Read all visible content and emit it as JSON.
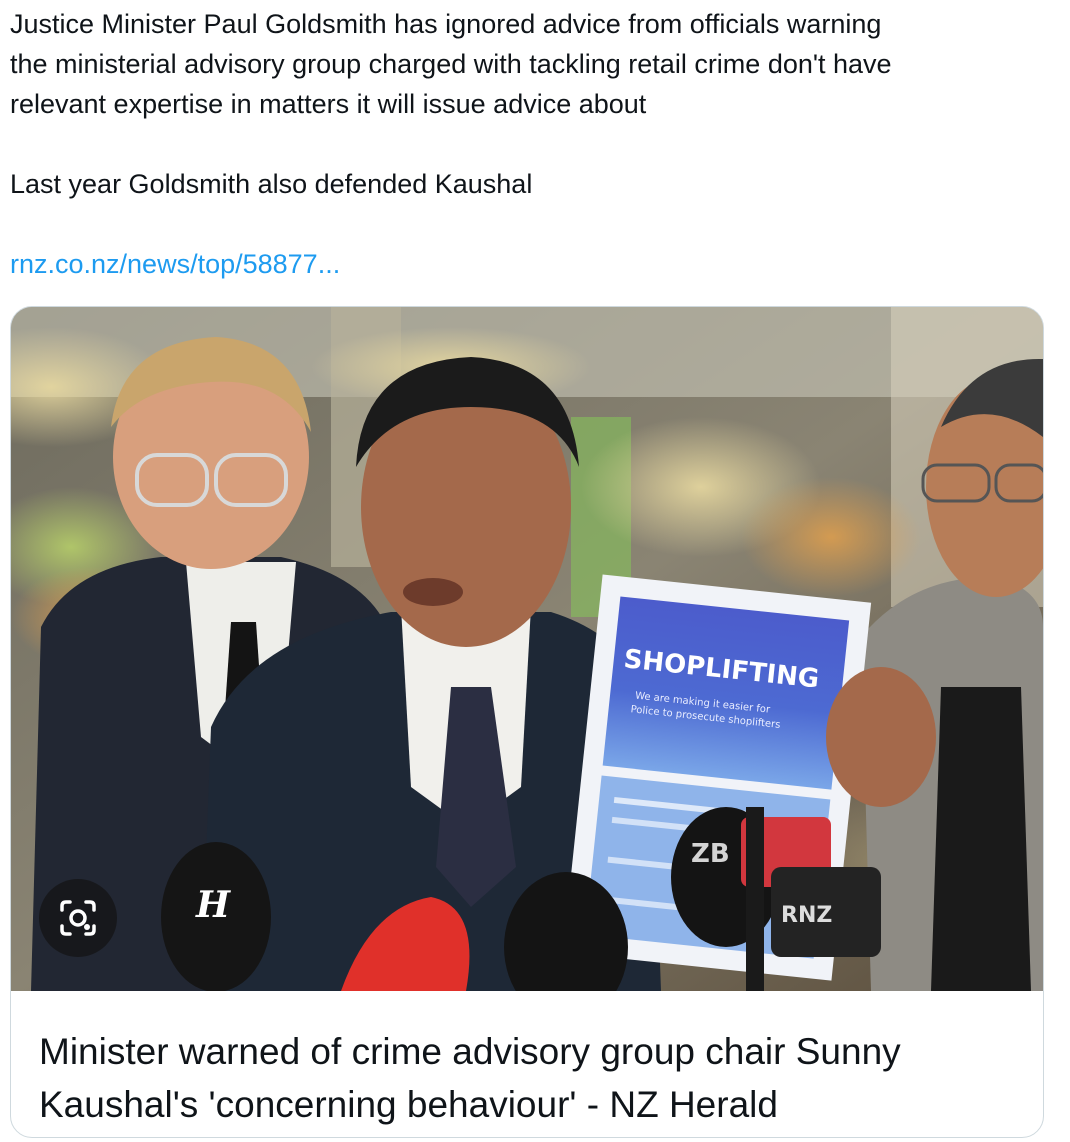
{
  "tweet": {
    "line1": "Justice Minister Paul Goldsmith has ignored advice from officials  warning",
    "line2": "the ministerial advisory group charged  with tackling retail crime don't have",
    "line3": "relevant expertise in matters it  will issue advice about",
    "line4": "Last year Goldsmith also defended Kaushal",
    "link": "rnz.co.nz/news/top/58877..."
  },
  "card": {
    "title_line1": "Minister warned of crime advisory group chair Sunny",
    "title_line2": "Kaushal's 'concerning behaviour' - NZ Herald",
    "photo": {
      "sign_title": "SHOPLIFTING",
      "sign_sub1": "We are making it easier for",
      "sign_sub2": "Police to prosecute shoplifters",
      "mic_logo_left": "H",
      "mic_logo_center": "ZB",
      "mic_logo_right": "RNZ"
    },
    "lens_icon": "visual-search-icon"
  },
  "colors": {
    "link": "#1d9bf0",
    "text": "#0f1419",
    "border": "#cfd9de",
    "sign_blue": "#4b5fc9"
  }
}
